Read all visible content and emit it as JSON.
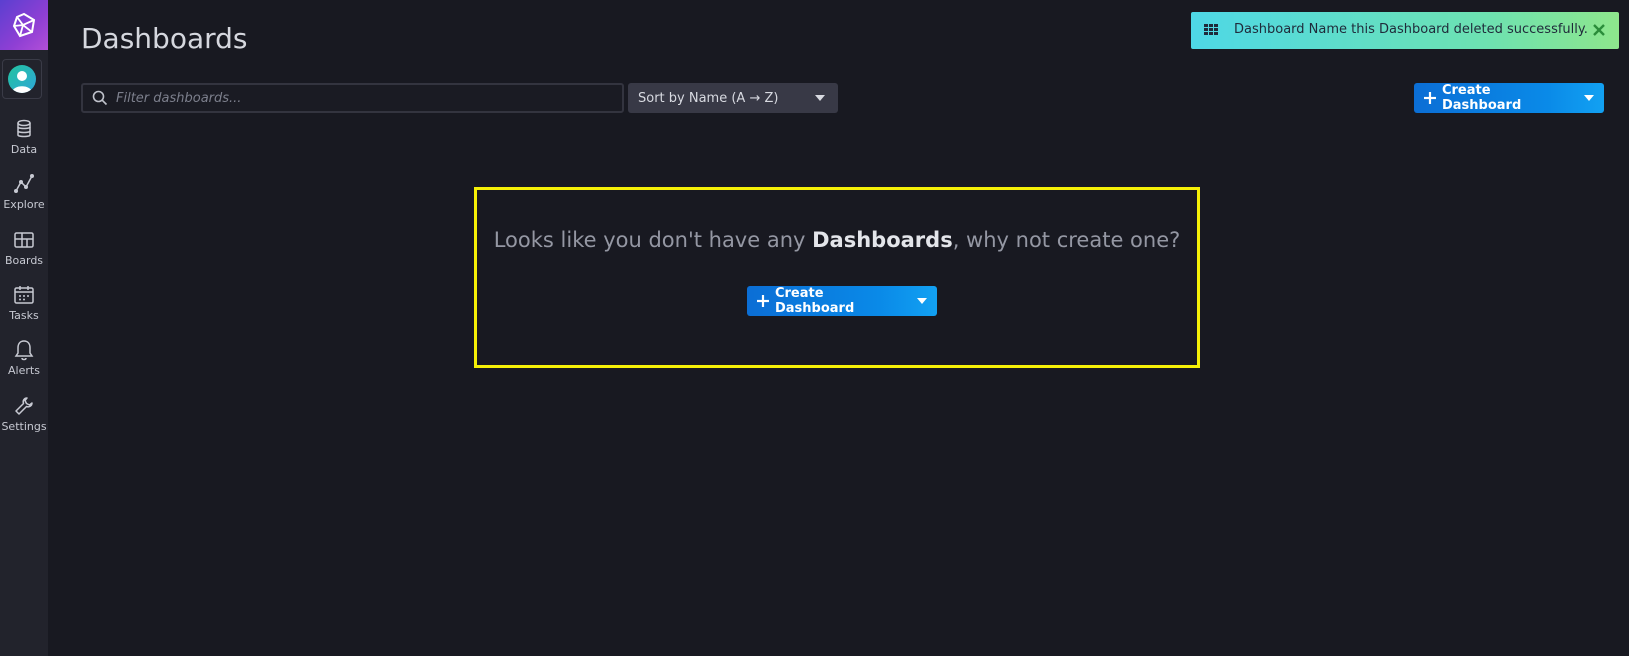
{
  "sidebar": {
    "logo_icon": "influx-logo-icon",
    "avatar_icon": "user-avatar-icon",
    "items": [
      {
        "label": "Data",
        "icon": "database-icon"
      },
      {
        "label": "Explore",
        "icon": "graph-line-icon"
      },
      {
        "label": "Boards",
        "icon": "dashboard-grid-icon"
      },
      {
        "label": "Tasks",
        "icon": "calendar-icon"
      },
      {
        "label": "Alerts",
        "icon": "bell-icon"
      },
      {
        "label": "Settings",
        "icon": "wrench-icon"
      }
    ]
  },
  "header": {
    "title": "Dashboards"
  },
  "toolbar": {
    "search_placeholder": "Filter dashboards...",
    "search_value": "",
    "sort_label": "Sort by Name (A → Z)",
    "create_label": "Create Dashboard"
  },
  "toast": {
    "message": "Dashboard Name this Dashboard deleted successfully.",
    "icon": "dashboard-grid-icon"
  },
  "empty_state": {
    "text_before": "Looks like you don't have any ",
    "text_emphasis": "Dashboards",
    "text_after": ", why not create one?",
    "create_label": "Create Dashboard"
  },
  "colors": {
    "background": "#181921",
    "sidebar": "#22232c",
    "primary_button": "#0a8ae8",
    "toast": "#6ee2b0",
    "highlight_border": "#f5f007"
  }
}
